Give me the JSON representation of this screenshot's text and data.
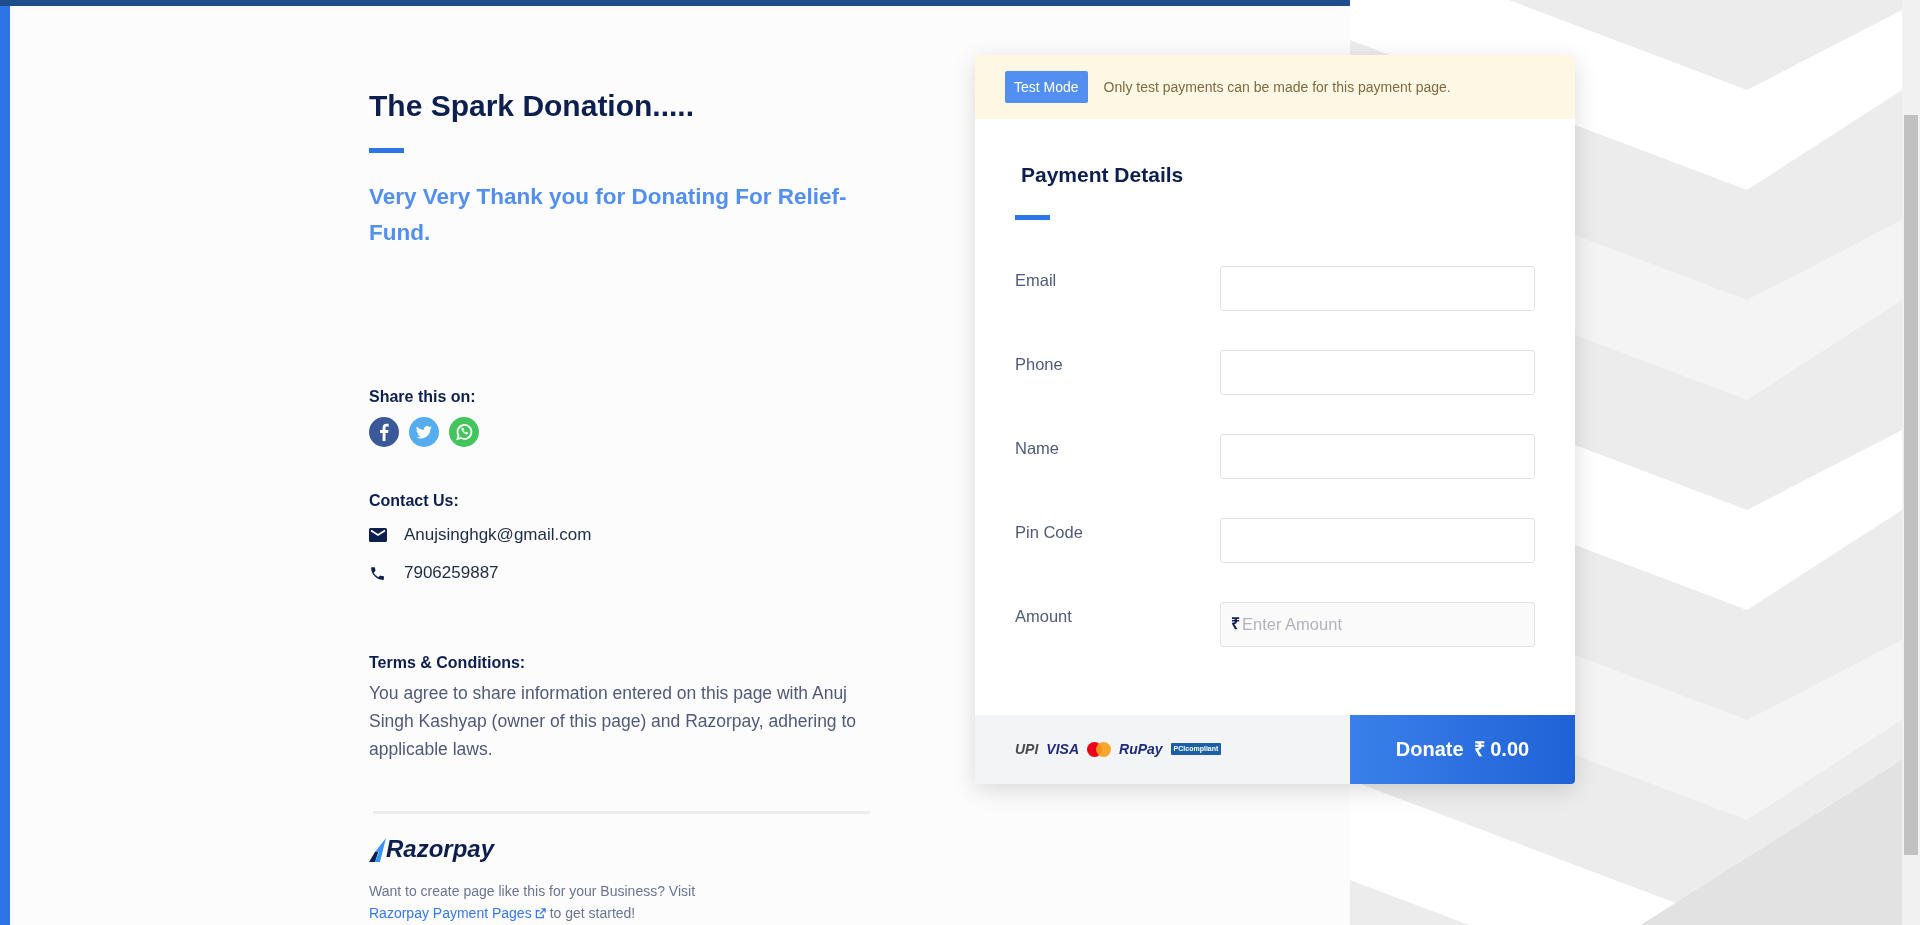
{
  "left": {
    "title": "The Spark Donation.....",
    "subtitle": "Very Very Thank you for Donating For Relief-Fund.",
    "share": {
      "heading": "Share this on:"
    },
    "contact": {
      "heading": "Contact Us:",
      "email": "Anujsinghgk@gmail.com",
      "phone": "7906259887"
    },
    "terms": {
      "heading": "Terms & Conditions:",
      "text": "You agree to share information entered on this page with Anuj Singh Kashyap (owner of this page) and Razorpay, adhering to applicable laws."
    },
    "footer": {
      "brand": "Razorpay",
      "text": "Want to create page like this for your Business? Visit",
      "link": "Razorpay Payment Pages",
      "after": "to get started!"
    }
  },
  "card": {
    "banner": {
      "badge": "Test Mode",
      "text": "Only test payments can be made for this payment page."
    },
    "title": "Payment Details",
    "fields": [
      {
        "label": "Email",
        "kind": "text"
      },
      {
        "label": "Phone",
        "kind": "text"
      },
      {
        "label": "Name",
        "kind": "text"
      },
      {
        "label": "Pin Code",
        "kind": "text"
      },
      {
        "label": "Amount",
        "kind": "amount",
        "prefix": "₹",
        "placeholder": "Enter Amount"
      }
    ],
    "logos": [
      "UPI",
      "VISA",
      "RuPay",
      "PCIcompliant"
    ],
    "donate": {
      "label": "Donate",
      "amount": "₹ 0.00"
    }
  }
}
